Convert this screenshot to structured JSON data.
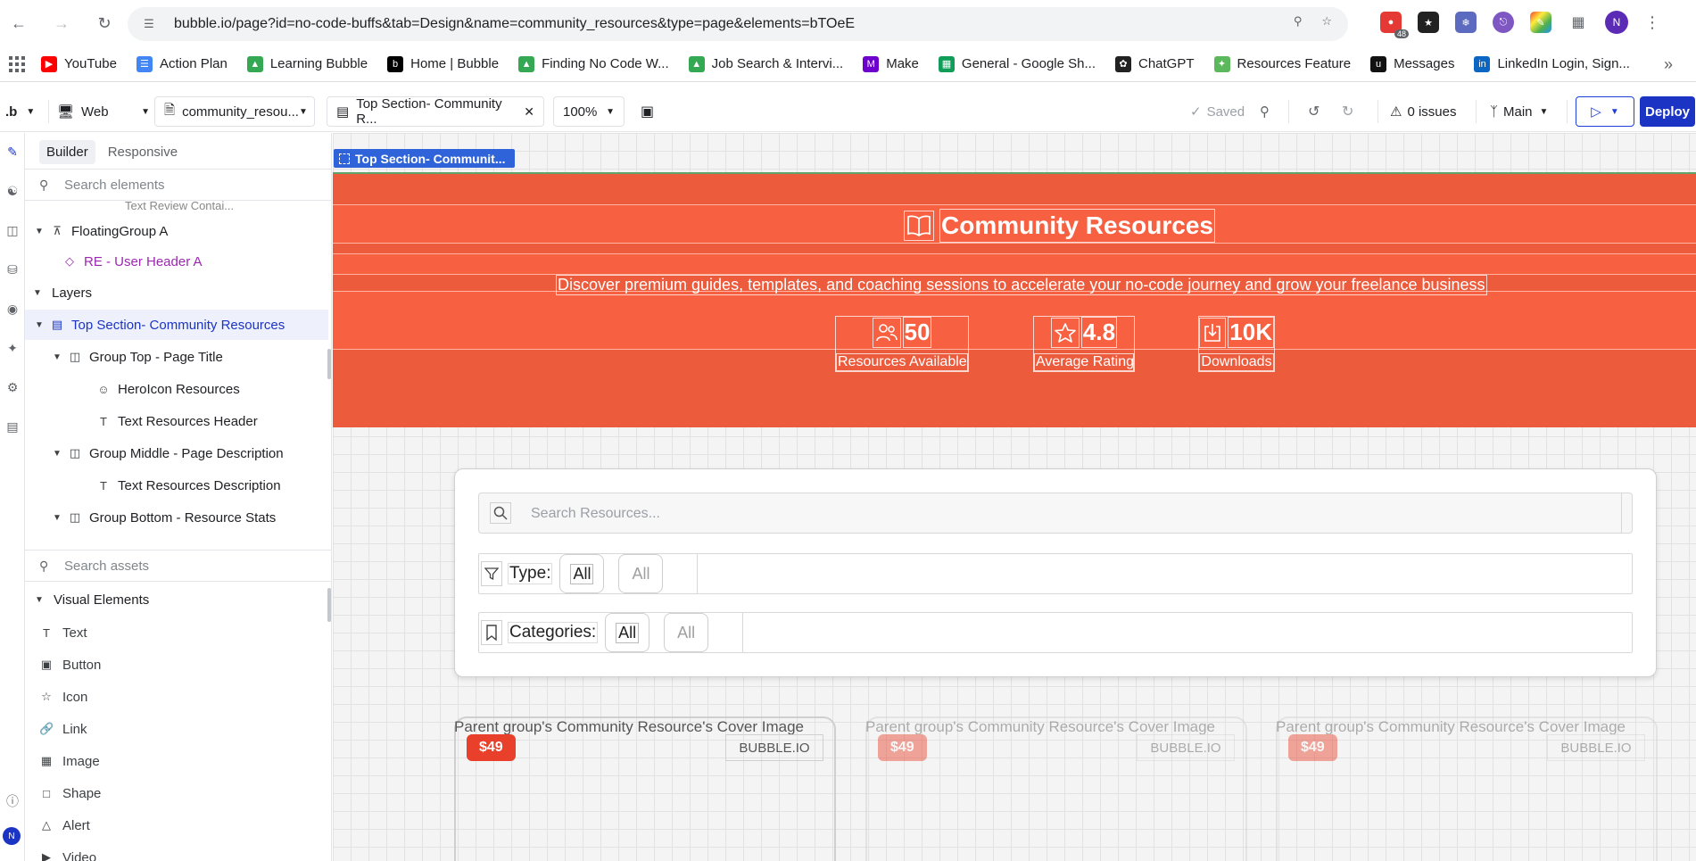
{
  "browser": {
    "url": "bubble.io/page?id=no-code-buffs&tab=Design&name=community_resources&type=page&elements=bTOeE",
    "extension_badge": "48",
    "profile_initial": "N",
    "bookmarks": [
      {
        "label": "YouTube",
        "icon_color": "#ff0000",
        "icon": "youtube-icon"
      },
      {
        "label": "Action Plan",
        "icon_color": "#4285f4",
        "icon": "docs-icon"
      },
      {
        "label": "Learning Bubble",
        "icon_color": "#34a853",
        "icon": "drive-icon"
      },
      {
        "label": "Home | Bubble",
        "icon_color": "#000000",
        "icon": "bubble-icon"
      },
      {
        "label": "Finding No Code W...",
        "icon_color": "#34a853",
        "icon": "drive-icon"
      },
      {
        "label": "Job Search & Intervi...",
        "icon_color": "#34a853",
        "icon": "drive-icon"
      },
      {
        "label": "Make",
        "icon_color": "#6d00cc",
        "icon": "make-icon"
      },
      {
        "label": "General - Google Sh...",
        "icon_color": "#0f9d58",
        "icon": "sheets-icon"
      },
      {
        "label": "ChatGPT",
        "icon_color": "#222222",
        "icon": "chatgpt-icon"
      },
      {
        "label": "Resources Feature",
        "icon_color": "#5cb85c",
        "icon": "puzzle-icon"
      },
      {
        "label": "Messages",
        "icon_color": "#111111",
        "icon": "upwork-icon"
      },
      {
        "label": "LinkedIn Login, Sign...",
        "icon_color": "#0a66c2",
        "icon": "linkedin-icon"
      }
    ]
  },
  "toolbar": {
    "logo": ".b",
    "device": "Web",
    "page": "community_resou...",
    "element": "Top Section- Community R...",
    "zoom": "100%",
    "saved": "Saved",
    "issues": "0 issues",
    "branch": "Main",
    "deploy": "Deploy"
  },
  "panel": {
    "tabs": [
      "Builder",
      "Responsive"
    ],
    "search_placeholder": "Search elements",
    "truncated_item": "Text Review Contai...",
    "tree": [
      {
        "label": "FloatingGroup A",
        "icon": "pin-icon"
      },
      {
        "label": "RE - User Header A",
        "icon": "diamond-icon"
      },
      {
        "label": "Layers"
      },
      {
        "label": "Top Section- Community Resources",
        "icon": "group-icon"
      },
      {
        "label": "Group Top - Page Title",
        "icon": "columns-icon"
      },
      {
        "label": "HeroIcon Resources",
        "icon": "smiley-icon"
      },
      {
        "label": "Text Resources Header",
        "icon": "text-icon"
      },
      {
        "label": "Group Middle - Page Description",
        "icon": "columns-icon"
      },
      {
        "label": "Text Resources Description",
        "icon": "text-icon"
      },
      {
        "label": "Group Bottom - Resource Stats",
        "icon": "columns-icon"
      }
    ],
    "assets_placeholder": "Search assets",
    "visual_elements_header": "Visual Elements",
    "assets": [
      "Text",
      "Button",
      "Icon",
      "Link",
      "Image",
      "Shape",
      "Alert",
      "Video"
    ]
  },
  "canvas": {
    "selection_tag": "Top Section- Communit...",
    "hero": {
      "title": "Community Resources",
      "description": "Discover premium guides, templates, and coaching sessions to accelerate your no-code journey and grow your freelance business",
      "stats": [
        {
          "value": "50",
          "label": "Resources Available",
          "icon": "users-icon"
        },
        {
          "value": "4.8",
          "label": "Average Rating",
          "icon": "star-icon"
        },
        {
          "value": "10K",
          "label": "Downloads",
          "icon": "download-icon"
        }
      ]
    },
    "filters": {
      "search_placeholder": "Search Resources...",
      "type_label": "Type:",
      "type_options": [
        "All",
        "All"
      ],
      "categories_label": "Categories:",
      "category_options": [
        "All",
        "All"
      ]
    },
    "cards": [
      {
        "caption": "Parent group's Community Resource's Cover Image",
        "price": "$49",
        "source": "BUBBLE.IO"
      },
      {
        "caption": "Parent group's Community Resource's Cover Image",
        "price": "$49",
        "source": "BUBBLE.IO"
      },
      {
        "caption": "Parent group's Community Resource's Cover Image",
        "price": "$49",
        "source": "BUBBLE.IO"
      }
    ],
    "colors": {
      "hero_bg": "#ed5b3d",
      "price_badge": "#e8402a",
      "accent": "#1b34c4"
    }
  }
}
